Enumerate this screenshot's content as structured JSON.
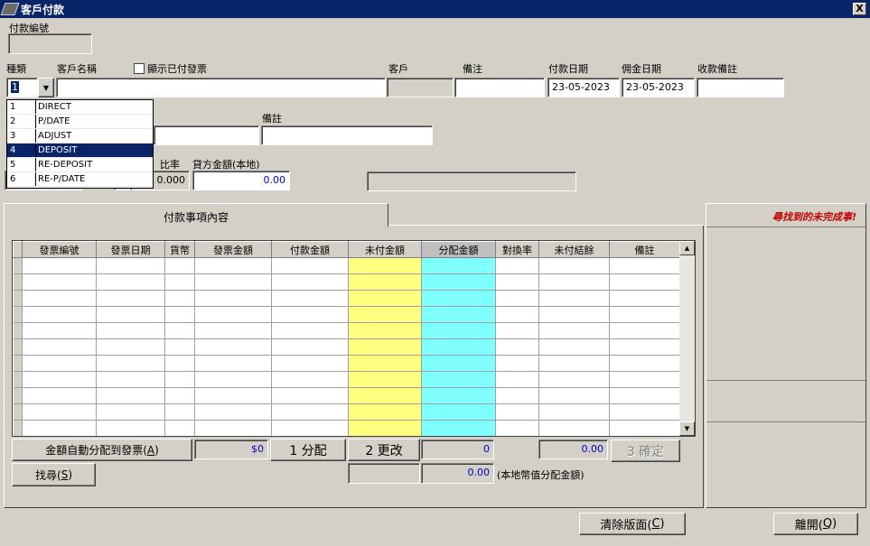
{
  "window": {
    "title": "客戶付款",
    "close_label": "X"
  },
  "form": {
    "payment_no_label": "付款編號",
    "payment_no_value": "",
    "type_label": "種類",
    "type_value": "1",
    "customer_name_label": "客戶名稱",
    "show_paid_label": "顯示已付發票",
    "customer_label": "客戶",
    "remark_label": "備注",
    "pay_date_label": "付款日期",
    "pay_date_value": "23-05-2023",
    "commission_date_label": "佣金日期",
    "commission_date_value": "23-05-2023",
    "receipt_remark_label": "收款備註",
    "remark2_label": "備註",
    "rate_label": "比率",
    "rate_value": "0.000",
    "credit_local_label": "貸方金額(本地)",
    "credit_local_value": "0.00"
  },
  "type_dropdown": {
    "items": [
      {
        "code": "1",
        "label": "DIRECT"
      },
      {
        "code": "2",
        "label": "P/DATE"
      },
      {
        "code": "3",
        "label": "ADJUST"
      },
      {
        "code": "4",
        "label": "DEPOSIT"
      },
      {
        "code": "5",
        "label": "RE-DEPOSIT"
      },
      {
        "code": "6",
        "label": "RE-P/DATE"
      }
    ],
    "selected_index": 3
  },
  "tab": {
    "label": "付款事項內容"
  },
  "side_panel": {
    "title": "尋找到的未完成事!"
  },
  "grid": {
    "columns": [
      "發票編號",
      "發票日期",
      "貨幣",
      "發票金額",
      "付款金額",
      "未付金額",
      "分配金額",
      "對換率",
      "未付結餘",
      "備註"
    ],
    "row_count": 11
  },
  "bottom": {
    "auto_allocate_label": "金額自動分配到發票(",
    "auto_allocate_key": "A",
    "auto_allocate_suffix": ")",
    "total_value": "$0",
    "allocate_label": "1 分配",
    "change_label": "2 更改",
    "alloc_value": "0",
    "balance_value": "0.00",
    "confirm_label": "3 確定",
    "find_label": "找尋(",
    "find_key": "S",
    "find_suffix": ")",
    "local_alloc_value": "0.00",
    "local_alloc_label": "(本地幣值分配金額)",
    "clear_label": "清除版面(",
    "clear_key": "C",
    "clear_suffix": ")",
    "exit_label": "離開(",
    "exit_key": "Q",
    "exit_suffix": ")"
  },
  "colors": {
    "titlebar": "#0a246a",
    "window_bg": "#d4d0c8",
    "unpaid_column": "#ffff80",
    "alloc_column": "#80ffff",
    "side_title": "#c00000",
    "value_blue": "#0000c0"
  }
}
